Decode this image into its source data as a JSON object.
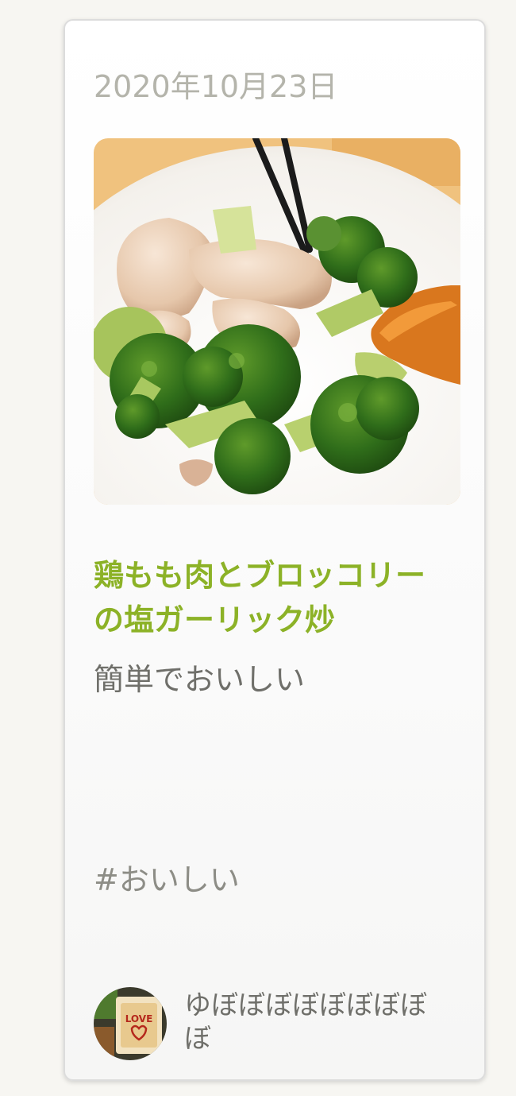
{
  "post": {
    "date": "2020年10月23日",
    "title": "鶏もも肉とブロッコリーの塩ガーリック炒",
    "description": "簡単でおいしい",
    "hashtag": "#おいしい",
    "author": "ゆぼぼぼぼぼぼぼぼぼ",
    "photo_icon": "food-photo",
    "avatar_icon": "user-avatar",
    "avatar_text": "LOVE"
  },
  "colors": {
    "title": "#8cb227",
    "date": "#b4b4ab",
    "body": "#6f6f6a"
  }
}
